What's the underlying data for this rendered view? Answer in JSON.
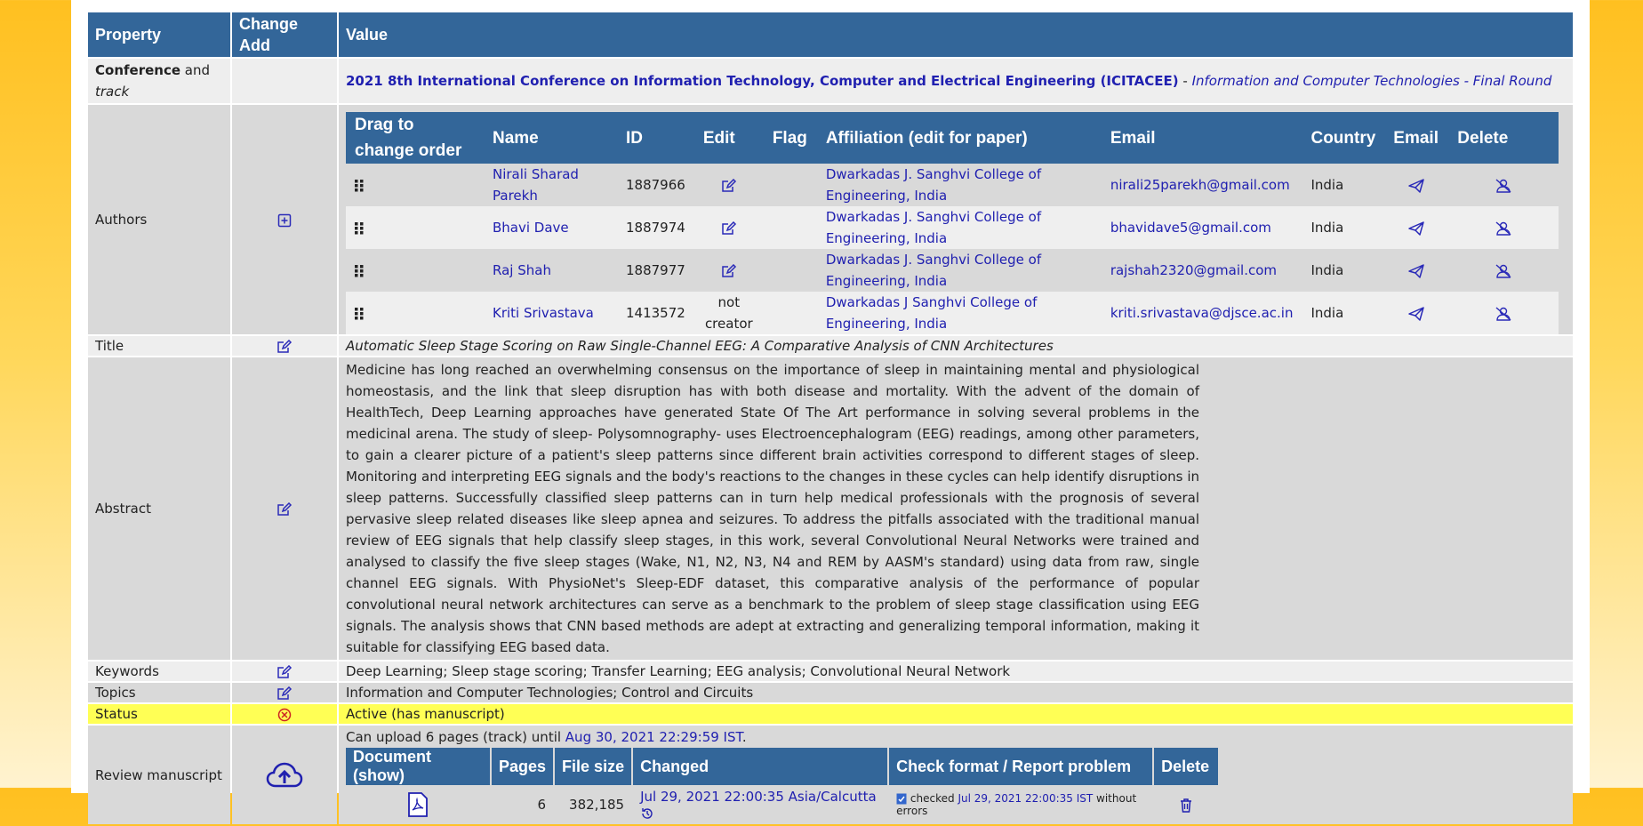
{
  "headers": {
    "property": "Property",
    "change_add": "Change Add",
    "value": "Value"
  },
  "conference": {
    "prop_bold": "Conference",
    "prop_and": " and ",
    "prop_italic": "track",
    "name": "2021 8th International Conference on Information Technology, Computer and Electrical Engineering (ICITACEE)",
    "separator": " - ",
    "track": "Information and Computer Technologies - Final Round"
  },
  "authors": {
    "label": "Authors",
    "columns": [
      "Drag to change order",
      "Name",
      "ID",
      "Edit",
      "Flag",
      "Affiliation (edit for paper)",
      "Email",
      "Country",
      "Email",
      "Delete"
    ],
    "rows": [
      {
        "name": "Nirali Sharad Parekh",
        "id": "1887966",
        "edit": "edit-icon",
        "affiliation": "Dwarkadas J. Sanghvi College of Engineering, India",
        "email": "nirali25parekh@gmail.com",
        "country": "India"
      },
      {
        "name": "Bhavi Dave",
        "id": "1887974",
        "edit": "edit-icon",
        "affiliation": "Dwarkadas J. Sanghvi College of Engineering, India",
        "email": "bhavidave5@gmail.com",
        "country": "India"
      },
      {
        "name": "Raj Shah",
        "id": "1887977",
        "edit": "edit-icon",
        "affiliation": "Dwarkadas J. Sanghvi College of Engineering, India",
        "email": "rajshah2320@gmail.com",
        "country": "India"
      },
      {
        "name": "Kriti Srivastava",
        "id": "1413572",
        "edit_text": "not creator",
        "affiliation": "Dwarkadas J Sanghvi College of Engineering, India",
        "email": "kriti.srivastava@djsce.ac.in",
        "country": "India"
      }
    ]
  },
  "title": {
    "label": "Title",
    "value": "Automatic Sleep Stage Scoring on Raw Single-Channel EEG: A Comparative Analysis of CNN Architectures"
  },
  "abstract": {
    "label": "Abstract",
    "value": "Medicine has long reached an overwhelming consensus on the importance of sleep in maintaining mental and physiological homeostasis, and the link that sleep disruption has with both disease and mortality. With the advent of the domain of HealthTech, Deep Learning approaches have generated State Of The Art performance in solving several problems in the medicinal arena. The study of sleep- Polysomnography- uses Electroencephalogram (EEG) readings, among other parameters, to gain a clearer picture of a patient's sleep patterns since different brain activities correspond to different stages of sleep. Monitoring and interpreting EEG signals and the body's reactions to the changes in these cycles can help identify disruptions in sleep patterns. Successfully classified sleep patterns can in turn help medical professionals with the prognosis of several pervasive sleep related diseases like sleep apnea and seizures. To address the pitfalls associated with the traditional manual review of EEG signals that help classify sleep stages, in this work, several Convolutional Neural Networks were trained and analysed to classify the five sleep stages (Wake, N1, N2, N3, N4 and REM by AASM's standard) using data from raw, single channel EEG signals. With PhysioNet's Sleep-EDF dataset, this comparative analysis of the performance of popular convolutional neural network architectures can serve as a benchmark to the problem of sleep stage classification using EEG signals. The analysis shows that CNN based methods are adept at extracting and generalizing temporal information, making it suitable for classifying EEG based data."
  },
  "keywords": {
    "label": "Keywords",
    "value": "Deep Learning; Sleep stage scoring; Transfer Learning; EEG analysis; Convolutional Neural Network"
  },
  "topics": {
    "label": "Topics",
    "value": "Information and Computer Technologies; Control and Circuits"
  },
  "status": {
    "label": "Status",
    "value": "Active (has manuscript)"
  },
  "review": {
    "label": "Review manuscript",
    "upload_text": "Can upload 6 pages (track) until ",
    "deadline": "Aug 30, 2021 22:29:59 IST",
    "deadline_end": ".",
    "doc_columns": [
      "Document (show)",
      "Pages",
      "File size",
      "Changed",
      "Check format / Report problem",
      "Delete"
    ],
    "doc": {
      "pages": "6",
      "size": "382,185",
      "changed": "Jul 29, 2021 22:00:35 Asia/Calcutta",
      "check_status": "checked",
      "check_time": "Jul 29, 2021 22:00:35 IST",
      "check_result": "without errors"
    }
  },
  "colors": {
    "header": "#336699",
    "link": "#2020b0",
    "status_bg": "#ffff55",
    "icon": "#2a2ab8"
  }
}
